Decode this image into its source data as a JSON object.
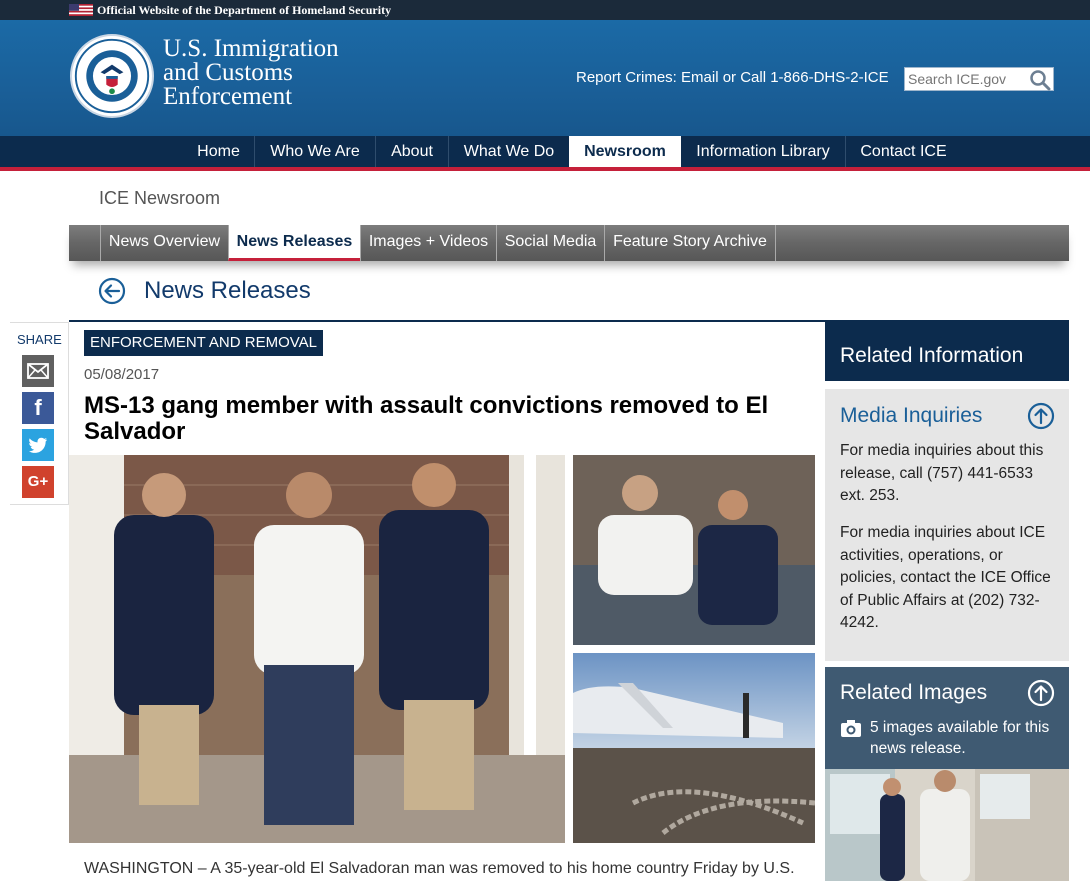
{
  "gov_banner": {
    "text": "Official Website of the Department of Homeland Security",
    "flag_icon": "us-flag-icon"
  },
  "header": {
    "agency_lines": [
      "U.S. Immigration",
      "and Customs",
      "Enforcement"
    ],
    "seal_icon": "dhs-seal-icon",
    "report_text": "Report Crimes: Email or Call 1-866-DHS-2-ICE",
    "search_placeholder": "Search ICE.gov",
    "search_icon": "magnifier-icon"
  },
  "main_nav": {
    "items": [
      {
        "label": "Home"
      },
      {
        "label": "Who We Are"
      },
      {
        "label": "About"
      },
      {
        "label": "What We Do"
      },
      {
        "label": "Newsroom",
        "active": true
      },
      {
        "label": "Information Library"
      },
      {
        "label": "Contact ICE"
      }
    ]
  },
  "newsroom": {
    "title": "ICE Newsroom",
    "subnav": [
      {
        "label": "News Overview"
      },
      {
        "label": "News Releases",
        "active": true
      },
      {
        "label": "Images + Videos"
      },
      {
        "label": "Social Media"
      },
      {
        "label": "Feature Story Archive"
      }
    ],
    "page_title": "News Releases",
    "back_icon": "circle-arrow-left-icon"
  },
  "share": {
    "label": "SHARE",
    "buttons": [
      "email-icon",
      "facebook-icon",
      "twitter-icon",
      "google-plus-icon"
    ],
    "glyphs": {
      "facebook": "f",
      "twitter": "t",
      "googleplus": "G+"
    }
  },
  "article": {
    "category": "ENFORCEMENT AND REMOVAL",
    "date": "05/08/2017",
    "headline": "MS-13 gang member with assault convictions removed to El Salvador",
    "body_start": "WASHINGTON – A 35-year-old El Salvadoran man was removed to his home country Friday by U.S."
  },
  "related": {
    "header": "Related Information",
    "media": {
      "title": "Media Inquiries",
      "para1": "For media inquiries about this release, call (757) 441-6533 ext. 253.",
      "para2": "For media inquiries about ICE activities, operations, or policies, contact the ICE Office of Public Affairs at (202) 732-4242."
    },
    "images": {
      "title": "Related Images",
      "count_text": "5 images available for this news release."
    }
  },
  "colors": {
    "navy": "#0c2b4d",
    "brand_blue": "#1a5f98",
    "accent_red": "#c5203a"
  }
}
